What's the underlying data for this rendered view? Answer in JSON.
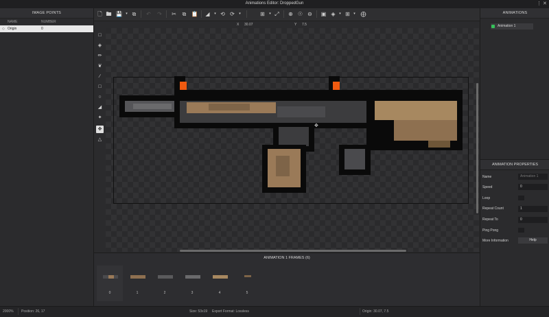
{
  "window": {
    "title": "Animations Editor: DroppedGun",
    "menu_icon": "more-vertical-icon",
    "close_icon": "close-icon"
  },
  "image_points": {
    "header": "IMAGE POINTS",
    "columns": [
      "NAME",
      "NUMBER"
    ],
    "rows": [
      {
        "name": "Origin",
        "number": "0"
      }
    ]
  },
  "toolbar": {
    "icons": [
      "new-file-icon",
      "open-folder-icon",
      "save-icon",
      "export-icon",
      "undo-icon",
      "redo-icon",
      "cut-icon",
      "copy-icon",
      "paste-icon",
      "flip-icon",
      "rotate-ccw-icon",
      "rotate-cw-icon",
      "crop-icon",
      "resize-icon",
      "zoom-in-icon",
      "zoom-reset-icon",
      "zoom-out-icon",
      "layers-icon",
      "grid-icon",
      "center-icon"
    ]
  },
  "coords": {
    "x_label": "X",
    "x_value": "30.07",
    "y_label": "Y",
    "y_value": "7.5"
  },
  "tools": [
    "select-icon",
    "eraser-icon",
    "pencil-icon",
    "brush-icon",
    "line-icon",
    "rectangle-icon",
    "ellipse-icon",
    "fill-icon",
    "eyedropper-icon",
    "origin-point-icon",
    "node-icon"
  ],
  "frames": {
    "header": "ANIMATION 1 FRAMES (6)",
    "items": [
      "0",
      "1",
      "2",
      "3",
      "4",
      "5"
    ]
  },
  "animations": {
    "header": "ANIMATIONS",
    "items": [
      {
        "name": "Animation 1",
        "color": "#36c25a"
      }
    ]
  },
  "properties": {
    "header": "ANIMATION PROPERTIES",
    "name_label": "Name",
    "name_placeholder": "Animation 1",
    "speed_label": "Speed",
    "speed_value": "0",
    "loop_label": "Loop",
    "repeat_count_label": "Repeat Count",
    "repeat_count_value": "1",
    "repeat_to_label": "Repeat To",
    "repeat_to_value": "0",
    "ping_pong_label": "Ping Pong",
    "more_info_label": "More Information",
    "help_label": "Help"
  },
  "status": {
    "zoom": "2000%",
    "position": "Position: 26, 17",
    "size": "Size: 53x19",
    "export_format": "Export Format: Lossless",
    "origin": "Origin: 30.07, 7.5"
  },
  "colors": {
    "accent_orange": "#f05a10",
    "gun_tan": "#9a7a58",
    "gun_dark": "#3c3c3e"
  }
}
